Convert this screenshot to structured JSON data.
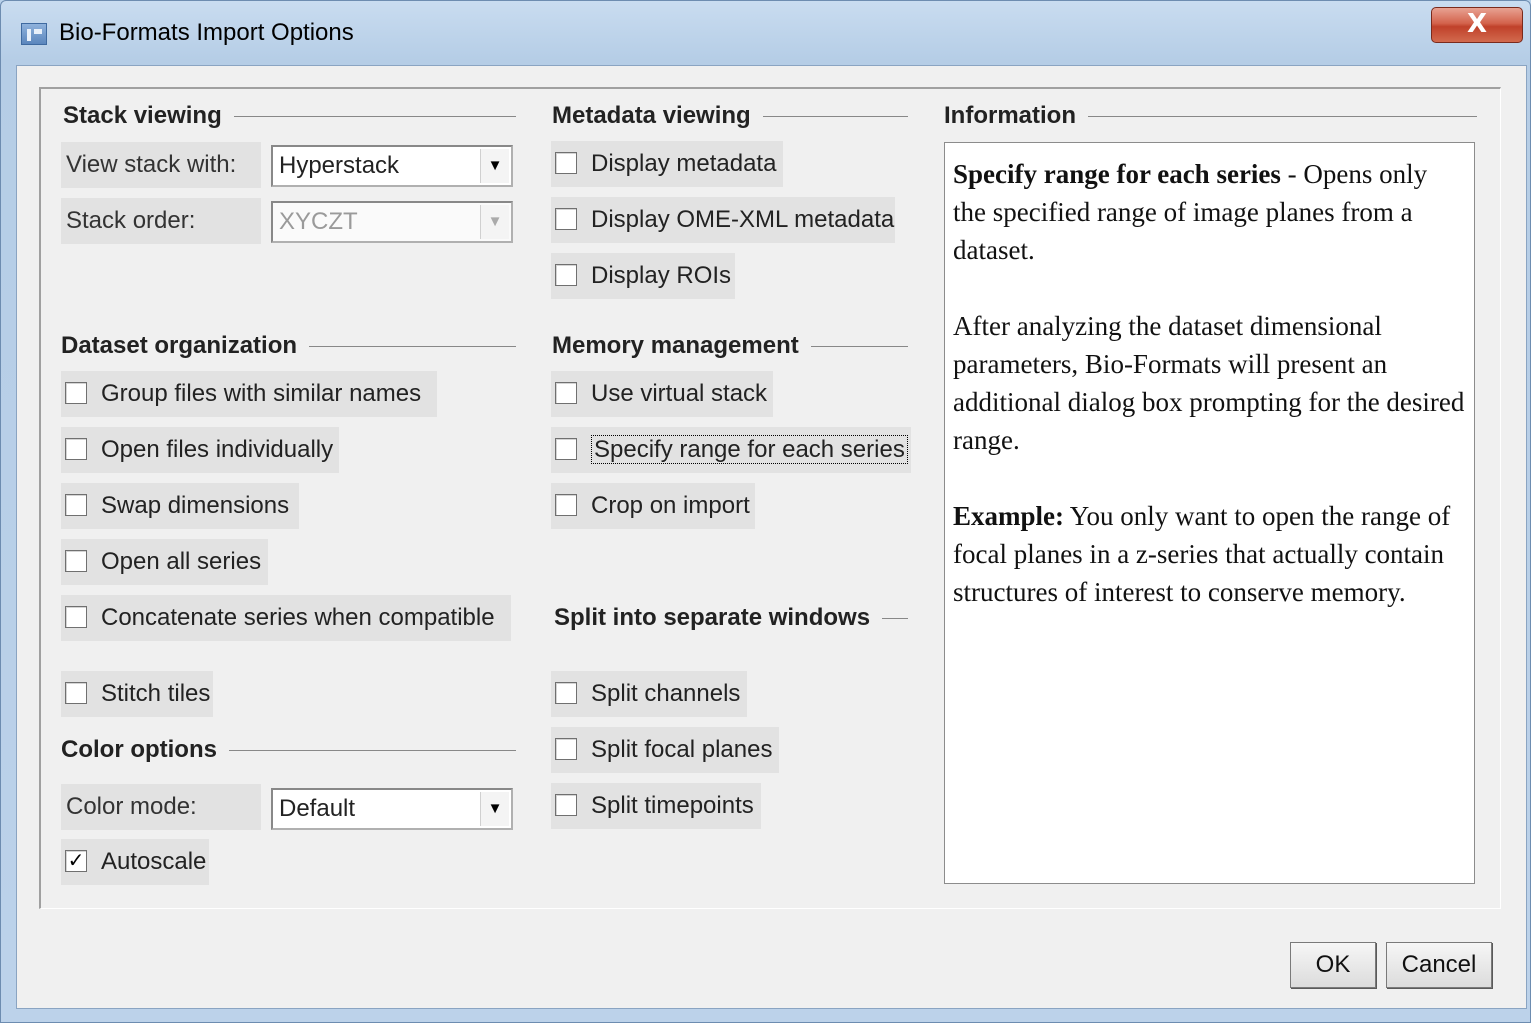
{
  "window": {
    "title": "Bio-Formats Import Options",
    "close_glyph": "X"
  },
  "stack_viewing": {
    "heading": "Stack viewing",
    "view_stack_label": "View stack with:",
    "view_stack_value": "Hyperstack",
    "stack_order_label": "Stack order:",
    "stack_order_value": "XYCZT"
  },
  "dataset_organization": {
    "heading": "Dataset organization",
    "items": [
      {
        "label": "Group files with similar names",
        "checked": false
      },
      {
        "label": "Open files individually",
        "checked": false
      },
      {
        "label": "Swap dimensions",
        "checked": false
      },
      {
        "label": "Open all series",
        "checked": false
      },
      {
        "label": "Concatenate series when compatible",
        "checked": false
      },
      {
        "label": "Stitch tiles",
        "checked": false
      }
    ]
  },
  "color_options": {
    "heading": "Color options",
    "color_mode_label": "Color mode:",
    "color_mode_value": "Default",
    "autoscale_label": "Autoscale",
    "autoscale_checked": true
  },
  "metadata_viewing": {
    "heading": "Metadata viewing",
    "items": [
      {
        "label": "Display metadata",
        "checked": false
      },
      {
        "label": "Display OME-XML metadata",
        "checked": false
      },
      {
        "label": "Display ROIs",
        "checked": false
      }
    ]
  },
  "memory_management": {
    "heading": "Memory management",
    "items": [
      {
        "label": "Use virtual stack",
        "checked": false
      },
      {
        "label": "Specify range for each series",
        "checked": false,
        "focused": true
      },
      {
        "label": "Crop on import",
        "checked": false
      }
    ]
  },
  "split_windows": {
    "heading": "Split into separate windows",
    "items": [
      {
        "label": "Split channels",
        "checked": false
      },
      {
        "label": "Split focal planes",
        "checked": false
      },
      {
        "label": "Split timepoints",
        "checked": false
      }
    ]
  },
  "information": {
    "heading": "Information",
    "p1_bold": "Specify range for each series",
    "p1_text": " - Opens only the specified range of image planes from a dataset.",
    "p2_text": "After analyzing the dataset dimensional parameters, Bio-Formats will present an additional dialog box prompting for the desired range.",
    "p3_bold": "Example:",
    "p3_text": " You only want to open the range of focal planes in a z-series that actually contain structures of interest to conserve memory."
  },
  "buttons": {
    "ok": "OK",
    "cancel": "Cancel"
  },
  "icons": {
    "dropdown": "chevron-down-icon",
    "check": "checkmark-icon",
    "app": "app-icon",
    "close": "close-icon"
  }
}
